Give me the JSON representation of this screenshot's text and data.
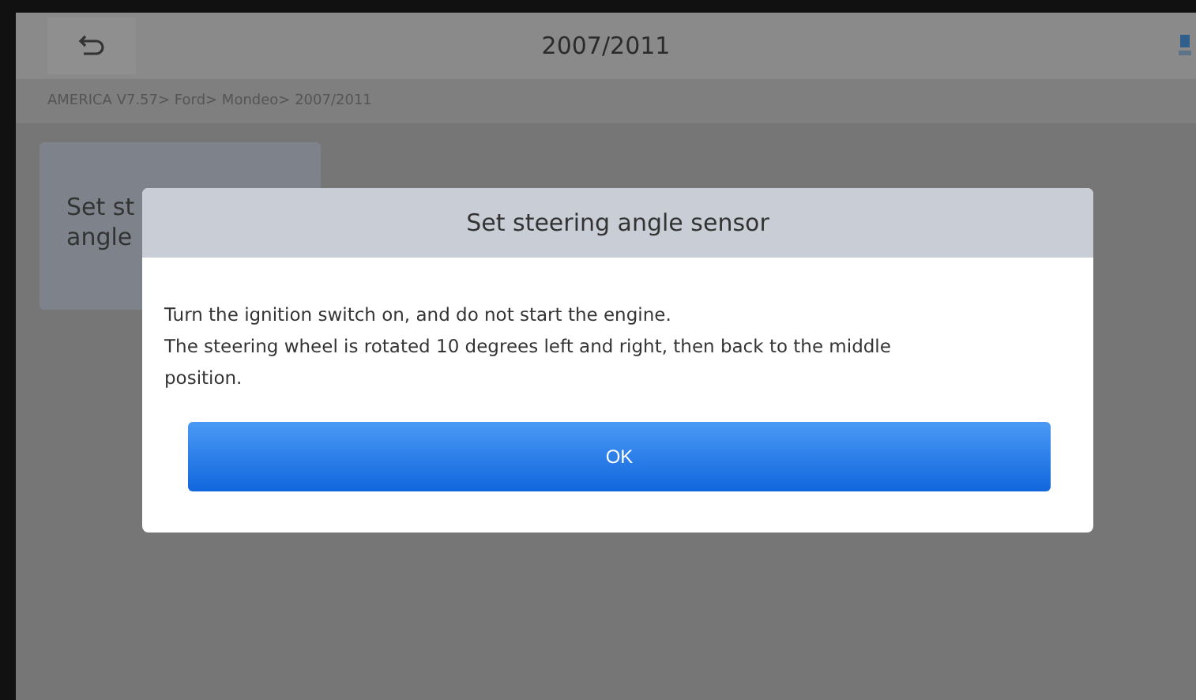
{
  "header": {
    "title": "2007/2011"
  },
  "breadcrumb": "AMERICA V7.57> Ford> Mondeo> 2007/2011",
  "function_card": {
    "lines": [
      "Set st",
      "angle"
    ]
  },
  "dialog": {
    "title": "Set steering angle sensor",
    "lines": [
      "Turn the ignition switch on, and do not start the engine.",
      "The steering wheel is rotated 10 degrees left and right, then back to the middle position."
    ],
    "buttons": [
      "OK"
    ]
  }
}
